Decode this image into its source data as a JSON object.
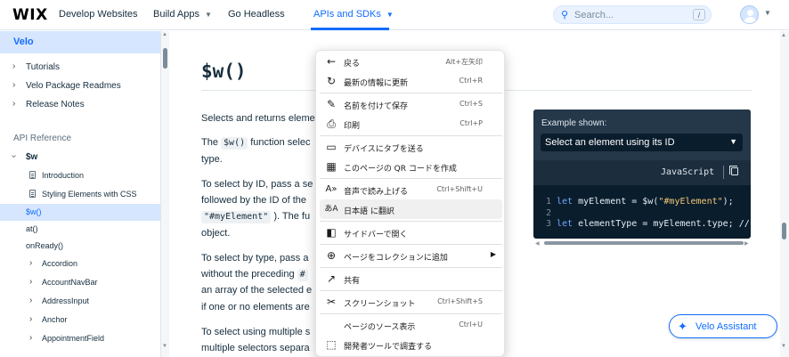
{
  "topnav": {
    "logo": "WIX",
    "items": [
      {
        "label": "Develop Websites"
      },
      {
        "label": "Build Apps"
      },
      {
        "label": "Go Headless"
      },
      {
        "label": "APIs and SDKs"
      }
    ],
    "search_placeholder": "Search...",
    "search_shortcut": "/"
  },
  "sidebar": {
    "header": "Velo",
    "top_items": [
      "Tutorials",
      "Velo Package Readmes",
      "Release Notes"
    ],
    "section_label": "API Reference",
    "group": "$w",
    "doc_items": [
      "Introduction",
      "Styling Elements with CSS"
    ],
    "selected_item": "$w()",
    "functions": [
      "at()",
      "onReady()"
    ],
    "elements": [
      "Accordion",
      "AccountNavBar",
      "AddressInput",
      "Anchor",
      "AppointmentField"
    ]
  },
  "main": {
    "title": "$w()",
    "p1": "Selects and returns eleme",
    "p2_prefix": "The",
    "p2_code": "$w()",
    "p2_suffix": "function selec",
    "p2_line2": "type.",
    "p3_line1": "To select by ID, pass a se",
    "p3_line2": "followed by the ID of the",
    "p3_code": "\"#myElement\"",
    "p3_line3_suffix": "). The fu",
    "p3_line4": "object.",
    "p4_line1": "To select by type, pass a",
    "p4_line2_prefix": "without the preceding",
    "p4_code": "#",
    "p4_line3": "an array of the selected e",
    "p4_line4": "if one or no elements are",
    "p5_line1": "To select using multiple s",
    "p5_line2": "multiple selectors separa"
  },
  "example": {
    "label": "Example shown:",
    "selected": "Select an element using its ID",
    "language": "JavaScript",
    "line_numbers": [
      "1",
      "2",
      "3"
    ],
    "line1": {
      "kw": "let",
      "rest": " myElement = $w(",
      "str": "\"#myElement\"",
      "end": ");"
    },
    "line3": {
      "kw": "let",
      "rest": " elementType = myElement.type; //"
    }
  },
  "assistant": {
    "label": "Velo Assistant"
  },
  "context_menu": {
    "items": [
      {
        "icon": "back-arrow-icon",
        "label": "戻る",
        "shortcut": "Alt+左矢印"
      },
      {
        "icon": "refresh-icon",
        "label": "最新の情報に更新",
        "shortcut": "Ctrl+R"
      },
      {
        "icon": "save-icon",
        "label": "名前を付けて保存",
        "shortcut": "Ctrl+S"
      },
      {
        "icon": "print-icon",
        "label": "印刷",
        "shortcut": "Ctrl+P"
      },
      {
        "icon": "send-to-device-icon",
        "label": "デバイスにタブを送る",
        "shortcut": ""
      },
      {
        "icon": "qr-code-icon",
        "label": "このページの QR コードを作成",
        "shortcut": ""
      },
      {
        "icon": "read-aloud-icon",
        "label": "音声で読み上げる",
        "shortcut": "Ctrl+Shift+U"
      },
      {
        "icon": "translate-icon",
        "label": "日本語 に翻訳",
        "shortcut": ""
      },
      {
        "icon": "sidebar-icon",
        "label": "サイドバーで開く",
        "shortcut": ""
      },
      {
        "icon": "collection-icon",
        "label": "ページをコレクションに追加",
        "shortcut": ""
      },
      {
        "icon": "share-icon",
        "label": "共有",
        "shortcut": ""
      },
      {
        "icon": "screenshot-icon",
        "label": "スクリーンショット",
        "shortcut": "Ctrl+Shift+S"
      },
      {
        "icon": "",
        "label": "ページのソース表示",
        "shortcut": "Ctrl+U"
      },
      {
        "icon": "devtools-icon",
        "label": "開発者ツールで調査する",
        "shortcut": ""
      }
    ]
  }
}
